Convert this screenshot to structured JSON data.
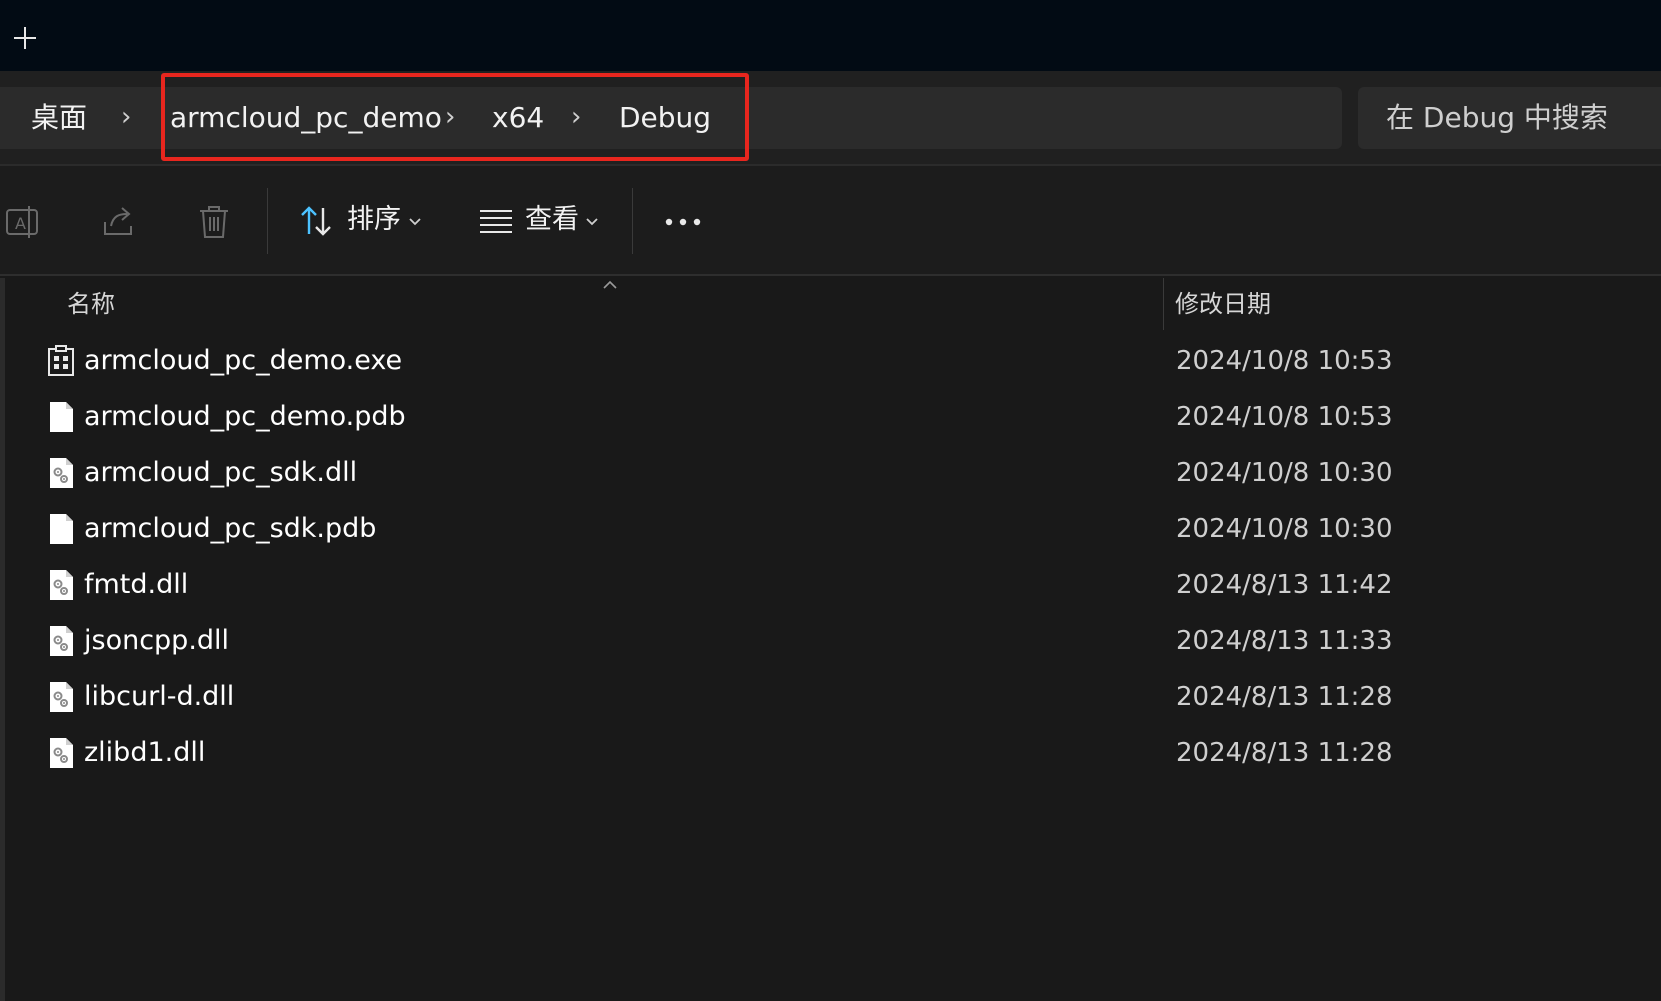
{
  "tabstrip": {
    "new_tab_icon": "plus-icon"
  },
  "breadcrumb": {
    "items": [
      "桌面",
      "armcloud_pc_demo",
      "x64",
      "Debug"
    ],
    "separator_icon": "chevron-right-icon",
    "highlight_color": "#e8261e"
  },
  "search": {
    "placeholder": "在 Debug 中搜索"
  },
  "toolbar": {
    "rename_icon": "rename-icon",
    "share_icon": "share-icon",
    "delete_icon": "trash-icon",
    "sort_label": "排序",
    "view_label": "查看",
    "more_icon": "more-icon",
    "sort_icon_color": "#4cc2ff"
  },
  "columns": {
    "name": "名称",
    "modified": "修改日期"
  },
  "files": [
    {
      "name": "armcloud_pc_demo.exe",
      "modified": "2024/10/8 10:53",
      "icon": "exe-icon"
    },
    {
      "name": "armcloud_pc_demo.pdb",
      "modified": "2024/10/8 10:53",
      "icon": "file-icon"
    },
    {
      "name": "armcloud_pc_sdk.dll",
      "modified": "2024/10/8 10:30",
      "icon": "dll-icon"
    },
    {
      "name": "armcloud_pc_sdk.pdb",
      "modified": "2024/10/8 10:30",
      "icon": "file-icon"
    },
    {
      "name": "fmtd.dll",
      "modified": "2024/8/13 11:42",
      "icon": "dll-icon"
    },
    {
      "name": "jsoncpp.dll",
      "modified": "2024/8/13 11:33",
      "icon": "dll-icon"
    },
    {
      "name": "libcurl-d.dll",
      "modified": "2024/8/13 11:28",
      "icon": "dll-icon"
    },
    {
      "name": "zlibd1.dll",
      "modified": "2024/8/13 11:28",
      "icon": "dll-icon"
    }
  ]
}
